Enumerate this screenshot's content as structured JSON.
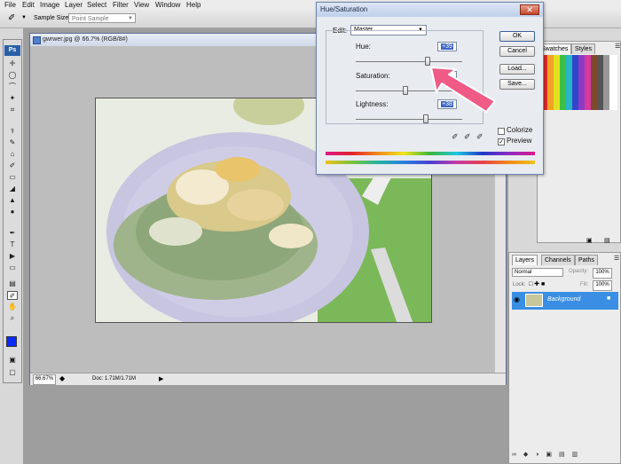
{
  "menubar": {
    "items": [
      "File",
      "Edit",
      "Image",
      "Layer",
      "Select",
      "Filter",
      "View",
      "Window",
      "Help"
    ]
  },
  "options_bar": {
    "sample_size_label": "Sample Size:",
    "sample_size_value": "Point Sample"
  },
  "tools": {
    "ps_logo": "Ps"
  },
  "document": {
    "title": "gwrwer.jpg @ 66.7% (RGB/8#)",
    "zoom": "66.67%",
    "doc_info": "Doc: 1.71M/1.71M"
  },
  "swatches_panel": {
    "tabs": [
      "Swatches",
      "Styles"
    ]
  },
  "layers_panel": {
    "tabs": [
      "Layers",
      "Channels",
      "Paths"
    ],
    "blend_mode": "Normal",
    "opacity_label": "Opacity:",
    "opacity_value": "100%",
    "lock_label": "Lock:",
    "fill_label": "Fill:",
    "fill_value": "100%",
    "layers": [
      {
        "name": "Background",
        "selected": true
      }
    ]
  },
  "hue_saturation_dialog": {
    "title": "Hue/Saturation",
    "edit_label": "Edit:",
    "edit_value": "Master",
    "hue_label": "Hue:",
    "hue_value": "+39",
    "saturation_label": "Saturation:",
    "saturation_value": "",
    "lightness_label": "Lightness:",
    "lightness_value": "+38",
    "buttons": {
      "ok": "OK",
      "cancel": "Cancel",
      "load": "Load...",
      "save": "Save..."
    },
    "colorize_label": "Colorize",
    "colorize_checked": false,
    "preview_label": "Preview",
    "preview_checked": true
  },
  "colors": {
    "accent_blue": "#2f7fd0",
    "arrow_pink": "#ef5a87",
    "foreground_swatch": "#0a2bff",
    "background_swatch": "#000000"
  }
}
